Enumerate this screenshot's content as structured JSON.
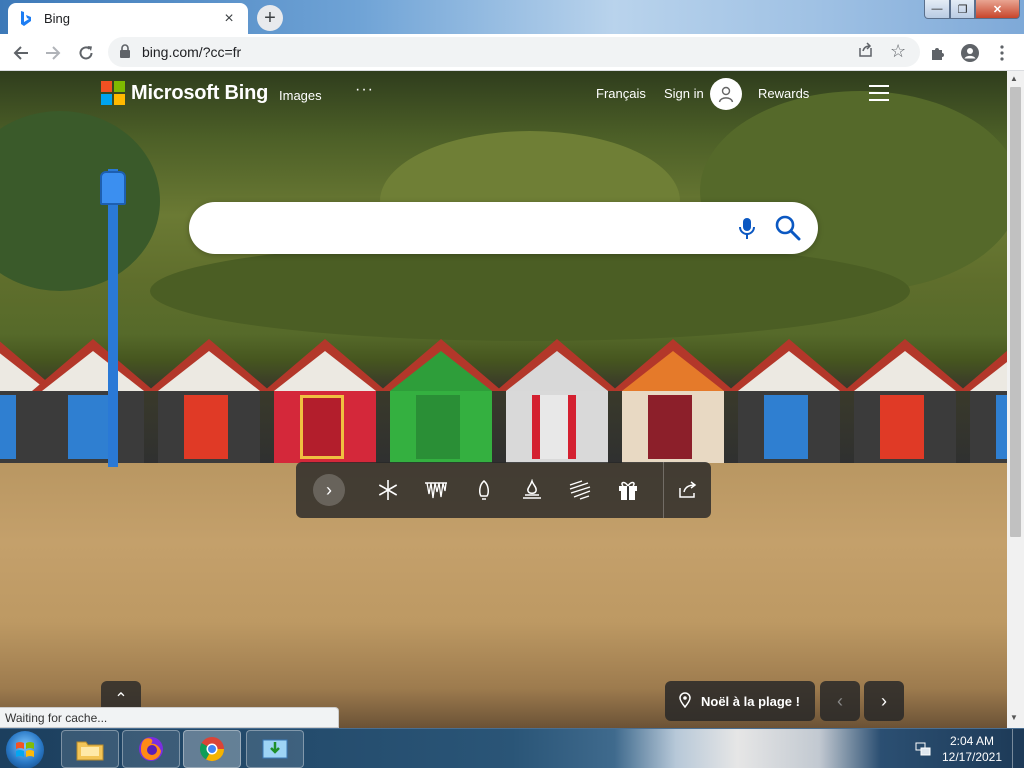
{
  "browser": {
    "tab_title": "Bing",
    "tab_close": "×",
    "new_tab": "+",
    "url": "bing.com/?cc=fr",
    "window": {
      "minimize": "—",
      "maximize": "❐",
      "close": "✕"
    }
  },
  "bing": {
    "logo_text": "Microsoft Bing",
    "logo_colors": [
      "#f25022",
      "#7fba00",
      "#00a4ef",
      "#ffb900"
    ],
    "nav": {
      "images": "Images",
      "more": "···",
      "language": "Français",
      "sign_in": "Sign in",
      "rewards": "Rewards"
    },
    "search": {
      "value": "",
      "placeholder": ""
    }
  },
  "theme_bar": {
    "next": "›",
    "icons": [
      "snowflake-icon",
      "icicles-icon",
      "bulb-icon",
      "fire-icon",
      "ribbon-icon",
      "gift-icon",
      "share-icon"
    ]
  },
  "page": {
    "scroll_up": "⌃",
    "caption": "Noël à la plage !",
    "prev": "‹",
    "next": "›",
    "status": "Waiting for cache..."
  },
  "taskbar": {
    "time": "2:04 AM",
    "date": "12/17/2021"
  }
}
